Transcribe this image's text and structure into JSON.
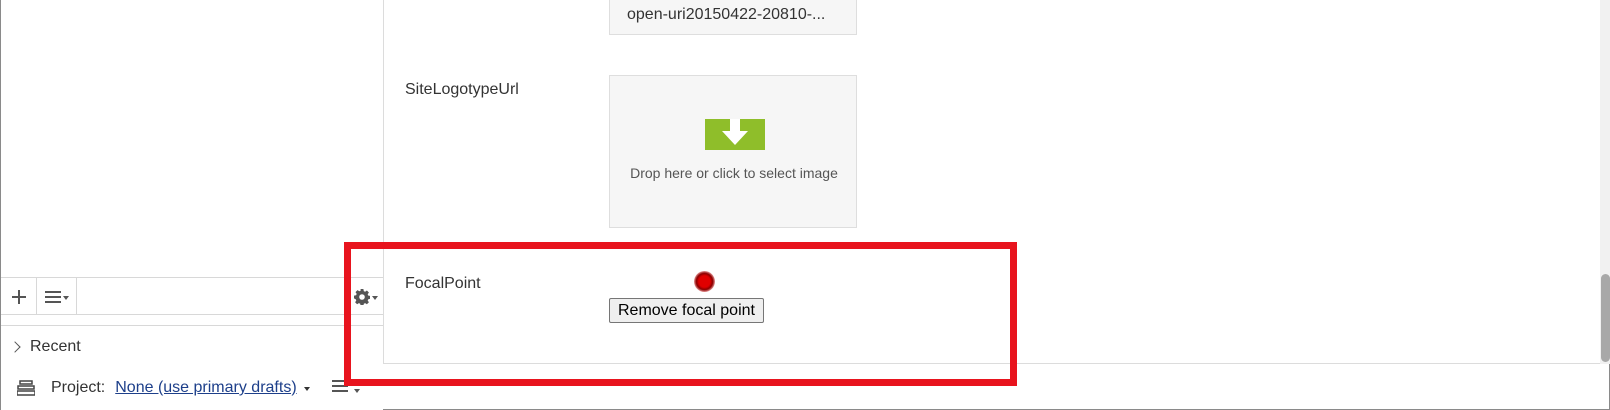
{
  "left_pane": {
    "toolbar": {
      "add_icon": "plus-icon",
      "list_icon": "list-menu-icon",
      "gear_icon": "gear-icon"
    },
    "recent": {
      "label": "Recent"
    },
    "project": {
      "label": "Project:",
      "value": "None (use primary drafts)",
      "icon": "project-stack-icon",
      "menu_icon": "list-menu-icon"
    }
  },
  "content": {
    "file_name": "open-uri20150422-20810-...",
    "site_logotype": {
      "label": "SiteLogotypeUrl",
      "drop_text": "Drop here or click to select image",
      "drop_icon": "download-arrow-icon",
      "icon_color": "#8fbe2a"
    },
    "focal_point": {
      "label": "FocalPoint",
      "remove_button": "Remove focal point"
    }
  },
  "highlight_color": "#e8141e"
}
